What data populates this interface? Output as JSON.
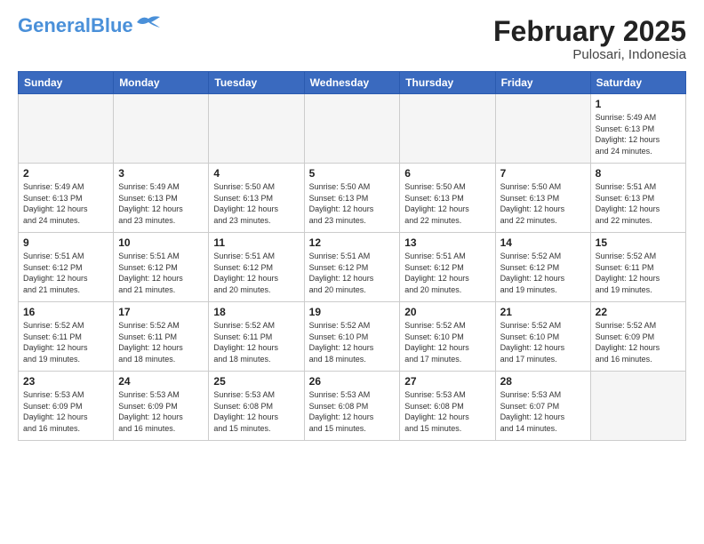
{
  "header": {
    "logo_general": "General",
    "logo_blue": "Blue",
    "month_title": "February 2025",
    "subtitle": "Pulosari, Indonesia"
  },
  "days_of_week": [
    "Sunday",
    "Monday",
    "Tuesday",
    "Wednesday",
    "Thursday",
    "Friday",
    "Saturday"
  ],
  "weeks": [
    [
      {
        "day": "",
        "info": ""
      },
      {
        "day": "",
        "info": ""
      },
      {
        "day": "",
        "info": ""
      },
      {
        "day": "",
        "info": ""
      },
      {
        "day": "",
        "info": ""
      },
      {
        "day": "",
        "info": ""
      },
      {
        "day": "1",
        "info": "Sunrise: 5:49 AM\nSunset: 6:13 PM\nDaylight: 12 hours\nand 24 minutes."
      }
    ],
    [
      {
        "day": "2",
        "info": "Sunrise: 5:49 AM\nSunset: 6:13 PM\nDaylight: 12 hours\nand 24 minutes."
      },
      {
        "day": "3",
        "info": "Sunrise: 5:49 AM\nSunset: 6:13 PM\nDaylight: 12 hours\nand 23 minutes."
      },
      {
        "day": "4",
        "info": "Sunrise: 5:50 AM\nSunset: 6:13 PM\nDaylight: 12 hours\nand 23 minutes."
      },
      {
        "day": "5",
        "info": "Sunrise: 5:50 AM\nSunset: 6:13 PM\nDaylight: 12 hours\nand 23 minutes."
      },
      {
        "day": "6",
        "info": "Sunrise: 5:50 AM\nSunset: 6:13 PM\nDaylight: 12 hours\nand 22 minutes."
      },
      {
        "day": "7",
        "info": "Sunrise: 5:50 AM\nSunset: 6:13 PM\nDaylight: 12 hours\nand 22 minutes."
      },
      {
        "day": "8",
        "info": "Sunrise: 5:51 AM\nSunset: 6:13 PM\nDaylight: 12 hours\nand 22 minutes."
      }
    ],
    [
      {
        "day": "9",
        "info": "Sunrise: 5:51 AM\nSunset: 6:12 PM\nDaylight: 12 hours\nand 21 minutes."
      },
      {
        "day": "10",
        "info": "Sunrise: 5:51 AM\nSunset: 6:12 PM\nDaylight: 12 hours\nand 21 minutes."
      },
      {
        "day": "11",
        "info": "Sunrise: 5:51 AM\nSunset: 6:12 PM\nDaylight: 12 hours\nand 20 minutes."
      },
      {
        "day": "12",
        "info": "Sunrise: 5:51 AM\nSunset: 6:12 PM\nDaylight: 12 hours\nand 20 minutes."
      },
      {
        "day": "13",
        "info": "Sunrise: 5:51 AM\nSunset: 6:12 PM\nDaylight: 12 hours\nand 20 minutes."
      },
      {
        "day": "14",
        "info": "Sunrise: 5:52 AM\nSunset: 6:12 PM\nDaylight: 12 hours\nand 19 minutes."
      },
      {
        "day": "15",
        "info": "Sunrise: 5:52 AM\nSunset: 6:11 PM\nDaylight: 12 hours\nand 19 minutes."
      }
    ],
    [
      {
        "day": "16",
        "info": "Sunrise: 5:52 AM\nSunset: 6:11 PM\nDaylight: 12 hours\nand 19 minutes."
      },
      {
        "day": "17",
        "info": "Sunrise: 5:52 AM\nSunset: 6:11 PM\nDaylight: 12 hours\nand 18 minutes."
      },
      {
        "day": "18",
        "info": "Sunrise: 5:52 AM\nSunset: 6:11 PM\nDaylight: 12 hours\nand 18 minutes."
      },
      {
        "day": "19",
        "info": "Sunrise: 5:52 AM\nSunset: 6:10 PM\nDaylight: 12 hours\nand 18 minutes."
      },
      {
        "day": "20",
        "info": "Sunrise: 5:52 AM\nSunset: 6:10 PM\nDaylight: 12 hours\nand 17 minutes."
      },
      {
        "day": "21",
        "info": "Sunrise: 5:52 AM\nSunset: 6:10 PM\nDaylight: 12 hours\nand 17 minutes."
      },
      {
        "day": "22",
        "info": "Sunrise: 5:52 AM\nSunset: 6:09 PM\nDaylight: 12 hours\nand 16 minutes."
      }
    ],
    [
      {
        "day": "23",
        "info": "Sunrise: 5:53 AM\nSunset: 6:09 PM\nDaylight: 12 hours\nand 16 minutes."
      },
      {
        "day": "24",
        "info": "Sunrise: 5:53 AM\nSunset: 6:09 PM\nDaylight: 12 hours\nand 16 minutes."
      },
      {
        "day": "25",
        "info": "Sunrise: 5:53 AM\nSunset: 6:08 PM\nDaylight: 12 hours\nand 15 minutes."
      },
      {
        "day": "26",
        "info": "Sunrise: 5:53 AM\nSunset: 6:08 PM\nDaylight: 12 hours\nand 15 minutes."
      },
      {
        "day": "27",
        "info": "Sunrise: 5:53 AM\nSunset: 6:08 PM\nDaylight: 12 hours\nand 15 minutes."
      },
      {
        "day": "28",
        "info": "Sunrise: 5:53 AM\nSunset: 6:07 PM\nDaylight: 12 hours\nand 14 minutes."
      },
      {
        "day": "",
        "info": ""
      }
    ]
  ]
}
